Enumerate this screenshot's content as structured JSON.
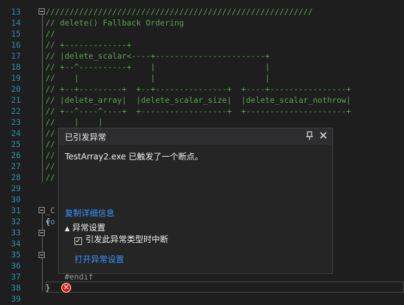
{
  "editor": {
    "lines": [
      {
        "num": "13",
        "text": "////////////////////////////////////////////////////////"
      },
      {
        "num": "14",
        "text": "// delete() Fallback Ordering"
      },
      {
        "num": "15",
        "text": "//"
      },
      {
        "num": "16",
        "text": "// +-------------+"
      },
      {
        "num": "17",
        "text": "// |delete_scalar<----+-----------------------+"
      },
      {
        "num": "18",
        "text": "// +--^----------+    |                       |"
      },
      {
        "num": "19",
        "text": "//    |               |                       |"
      },
      {
        "num": "20",
        "text": "// +--+---------+  +--+---------------+  +----+----------------+"
      },
      {
        "num": "21",
        "text": "// |delete_array|  |delete_scalar_size|  |delete_scalar_nothrow|"
      },
      {
        "num": "22",
        "text": "// +--^----^----+  +------------------+  +---------------------+"
      },
      {
        "num": "23",
        "text": "//    |    |"
      },
      {
        "num": "24",
        "text": "//"
      },
      {
        "num": "25",
        "text": "//"
      },
      {
        "num": "26",
        "text": "//"
      },
      {
        "num": "27",
        "text": "//"
      },
      {
        "num": "28",
        "text": "//"
      },
      {
        "num": "29",
        "text": ""
      },
      {
        "num": "30",
        "text": ""
      },
      {
        "num": "31",
        "text": "_C"
      },
      {
        "num": "31b",
        "text": "vo"
      },
      {
        "num": "32",
        "text": "{"
      },
      {
        "num": "33",
        "text": ""
      },
      {
        "num": "34",
        "text": ""
      },
      {
        "num": "35",
        "text": ""
      },
      {
        "num": "36",
        "text": ""
      },
      {
        "num": "37",
        "text": "    #endif"
      },
      {
        "num": "38",
        "text": "}"
      },
      {
        "num": "39",
        "text": ""
      }
    ]
  },
  "popup": {
    "title": "已引发异常",
    "pin_icon": "📌",
    "close_icon": "✕",
    "message": "TestArray2.exe 已触发了一个断点。",
    "copy_details": "复制详细信息",
    "section_title": "异常设置",
    "checkbox_label": "引发此异常类型时中断",
    "checkbox_checked": true,
    "open_settings": "打开异常设置"
  }
}
